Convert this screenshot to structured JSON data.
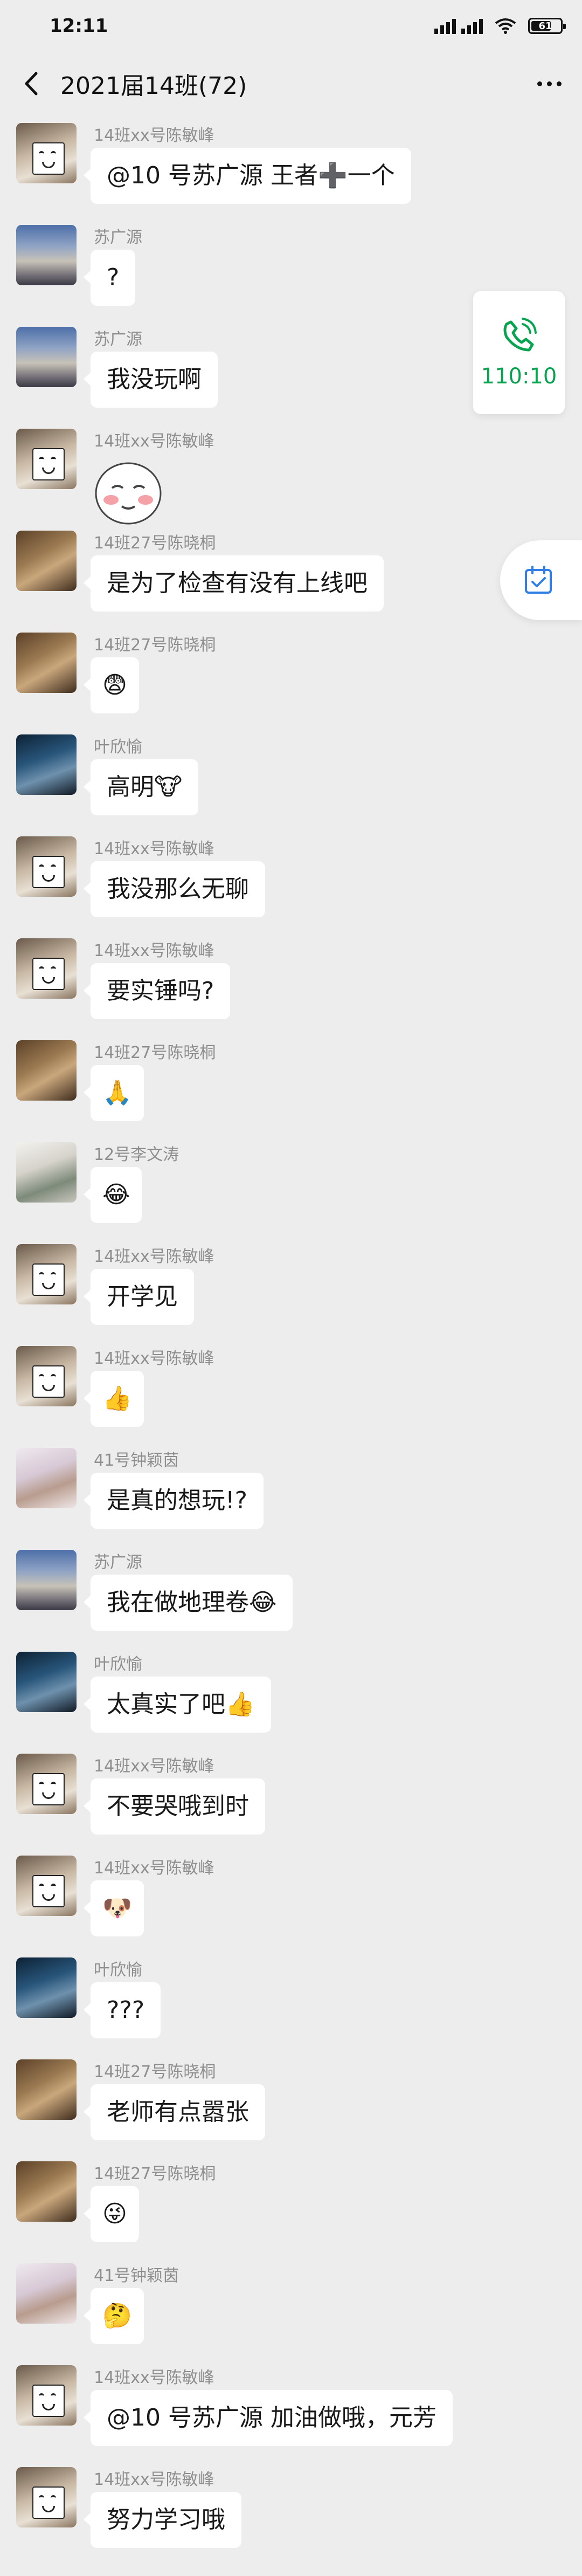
{
  "status_bar": {
    "time": "12:11",
    "battery": "61"
  },
  "header": {
    "title": "2021届14班(72)"
  },
  "call_card": {
    "time": "110:10"
  },
  "messages": [
    {
      "sender": "14班xx号陈敏峰",
      "text": "@10 号苏广源  王者➕一个",
      "avatar": "chen"
    },
    {
      "sender": "苏广源",
      "text": "?",
      "avatar": "su"
    },
    {
      "sender": "苏广源",
      "text": "我没玩啊",
      "avatar": "su"
    },
    {
      "sender": "14班xx号陈敏峰",
      "text": "",
      "avatar": "chen",
      "sticker": "blushing-face-sticker"
    },
    {
      "sender": "14班27号陈晓桐",
      "text": "是为了检查有没有上线吧",
      "avatar": "xiao"
    },
    {
      "sender": "14班27号陈晓桐",
      "text": "😨",
      "avatar": "xiao"
    },
    {
      "sender": "叶欣愉",
      "text": "高明🐮",
      "avatar": "ye"
    },
    {
      "sender": "14班xx号陈敏峰",
      "text": "我没那么无聊",
      "avatar": "chen"
    },
    {
      "sender": "14班xx号陈敏峰",
      "text": "要实锤吗?",
      "avatar": "chen"
    },
    {
      "sender": "14班27号陈晓桐",
      "text": "🙏",
      "avatar": "xiao"
    },
    {
      "sender": "12号李文涛",
      "text": "😂",
      "avatar": "li"
    },
    {
      "sender": "14班xx号陈敏峰",
      "text": "开学见",
      "avatar": "chen"
    },
    {
      "sender": "14班xx号陈敏峰",
      "text": "👍",
      "avatar": "chen"
    },
    {
      "sender": "41号钟颖茵",
      "text": "是真的想玩!?",
      "avatar": "zhong"
    },
    {
      "sender": "苏广源",
      "text": "我在做地理卷😂",
      "avatar": "su"
    },
    {
      "sender": "叶欣愉",
      "text": "太真实了吧👍",
      "avatar": "ye"
    },
    {
      "sender": "14班xx号陈敏峰",
      "text": "不要哭哦到时",
      "avatar": "chen"
    },
    {
      "sender": "14班xx号陈敏峰",
      "text": "🐶",
      "avatar": "chen"
    },
    {
      "sender": "叶欣愉",
      "text": "???",
      "avatar": "ye"
    },
    {
      "sender": "14班27号陈晓桐",
      "text": "老师有点嚣张",
      "avatar": "xiao"
    },
    {
      "sender": "14班27号陈晓桐",
      "text": "😜",
      "avatar": "xiao"
    },
    {
      "sender": "41号钟颖茵",
      "text": "🤔",
      "avatar": "zhong"
    },
    {
      "sender": "14班xx号陈敏峰",
      "text": "@10 号苏广源  加油做哦，元芳",
      "avatar": "chen"
    },
    {
      "sender": "14班xx号陈敏峰",
      "text": "努力学习哦",
      "avatar": "chen"
    }
  ],
  "colors": {
    "background": "#ededed",
    "bubble": "#ffffff",
    "accent_green": "#07a44f",
    "reminder_blue": "#2f7fe6"
  }
}
